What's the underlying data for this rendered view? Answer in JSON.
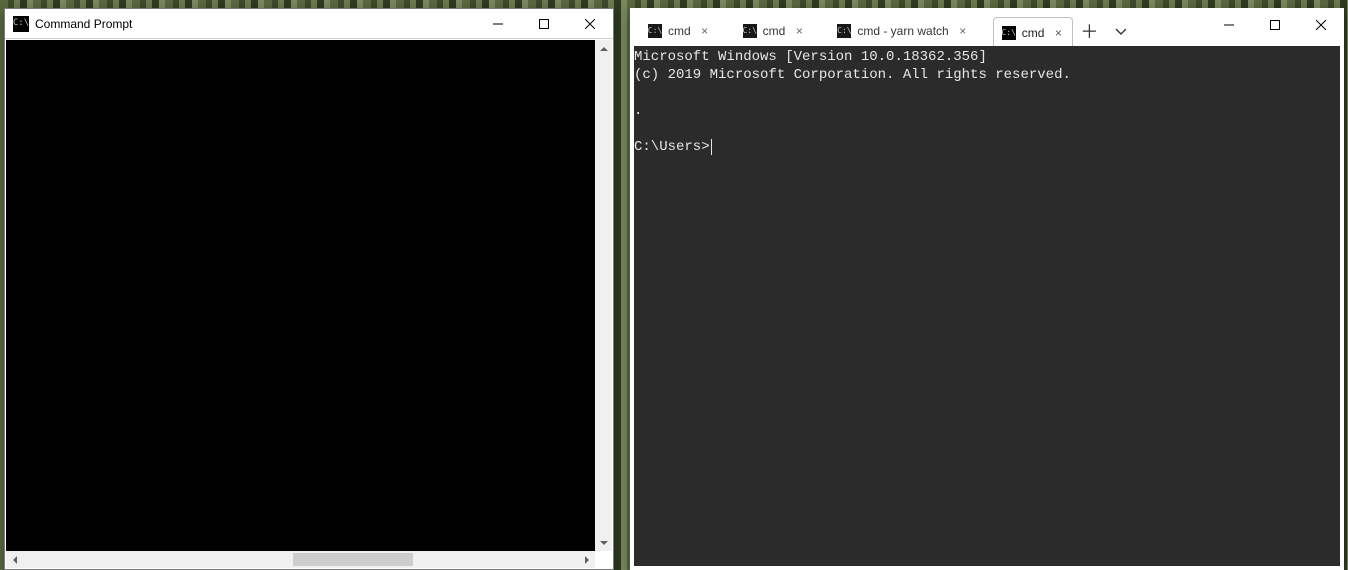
{
  "left_window": {
    "title": "Command Prompt",
    "icon_text": "C:\\"
  },
  "right_window": {
    "tabs": [
      {
        "label": "cmd",
        "active": false
      },
      {
        "label": "cmd",
        "active": false
      },
      {
        "label": "cmd - yarn watch",
        "active": false
      },
      {
        "label": "cmd",
        "active": true
      }
    ],
    "terminal": {
      "line1": "Microsoft Windows [Version 10.0.18362.356]",
      "line2": "(c) 2019 Microsoft Corporation. All rights reserved.",
      "prompt": "C:\\Users>"
    }
  }
}
